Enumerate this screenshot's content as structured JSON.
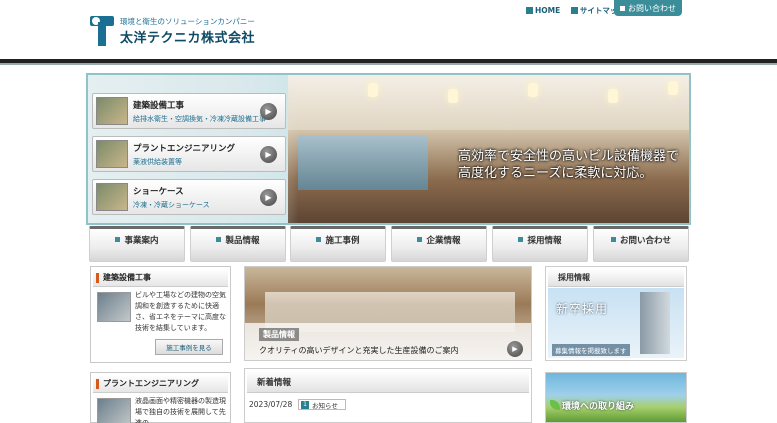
{
  "header": {
    "tagline": "環境と衛生のソリューションカンパニー",
    "company": "太洋テクニカ株式会社",
    "links": [
      "HOME",
      "サイトマップ"
    ],
    "contact": "お問い合わせ"
  },
  "hero": {
    "message_line1": "高効率で安全性の高いビル設備機器で",
    "message_line2": "高度化するニーズに柔軟に対応。",
    "categories": [
      {
        "title": "建築設備工事",
        "sub": "給排水衛生・空調換気・冷凍冷蔵設備工事"
      },
      {
        "title": "プラントエンジニアリング",
        "sub": "薬液供給装置等"
      },
      {
        "title": "ショーケース",
        "sub": "冷凍・冷蔵ショーケース"
      }
    ]
  },
  "nav": [
    "事業案内",
    "製品情報",
    "施工事例",
    "企業情報",
    "採用情報",
    "お問い合わせ"
  ],
  "left": {
    "box1": {
      "title": "建築設備工事",
      "text": "ビルや工場などの建物の空気調和を創造するために快適さ、省エネをテーマに高度な技術を結集しています。",
      "button": "施工事例を見る"
    },
    "box2": {
      "title": "プラントエンジニアリング",
      "text": "液晶画面や精密機器の製造現場で独自の技術を展開して先進の"
    }
  },
  "product": {
    "title": "製品情報",
    "desc": "クオリティの高いデザインと充実した生産設備のご案内"
  },
  "news": {
    "title": "新着情報",
    "date": "2023/07/28",
    "badge": "お知らせ",
    "badge_num": "1"
  },
  "recruit": {
    "title": "採用情報",
    "banner": "新卒採用",
    "link": "募集情報を掲載致します"
  },
  "env": {
    "title": "環境への取り組み"
  }
}
